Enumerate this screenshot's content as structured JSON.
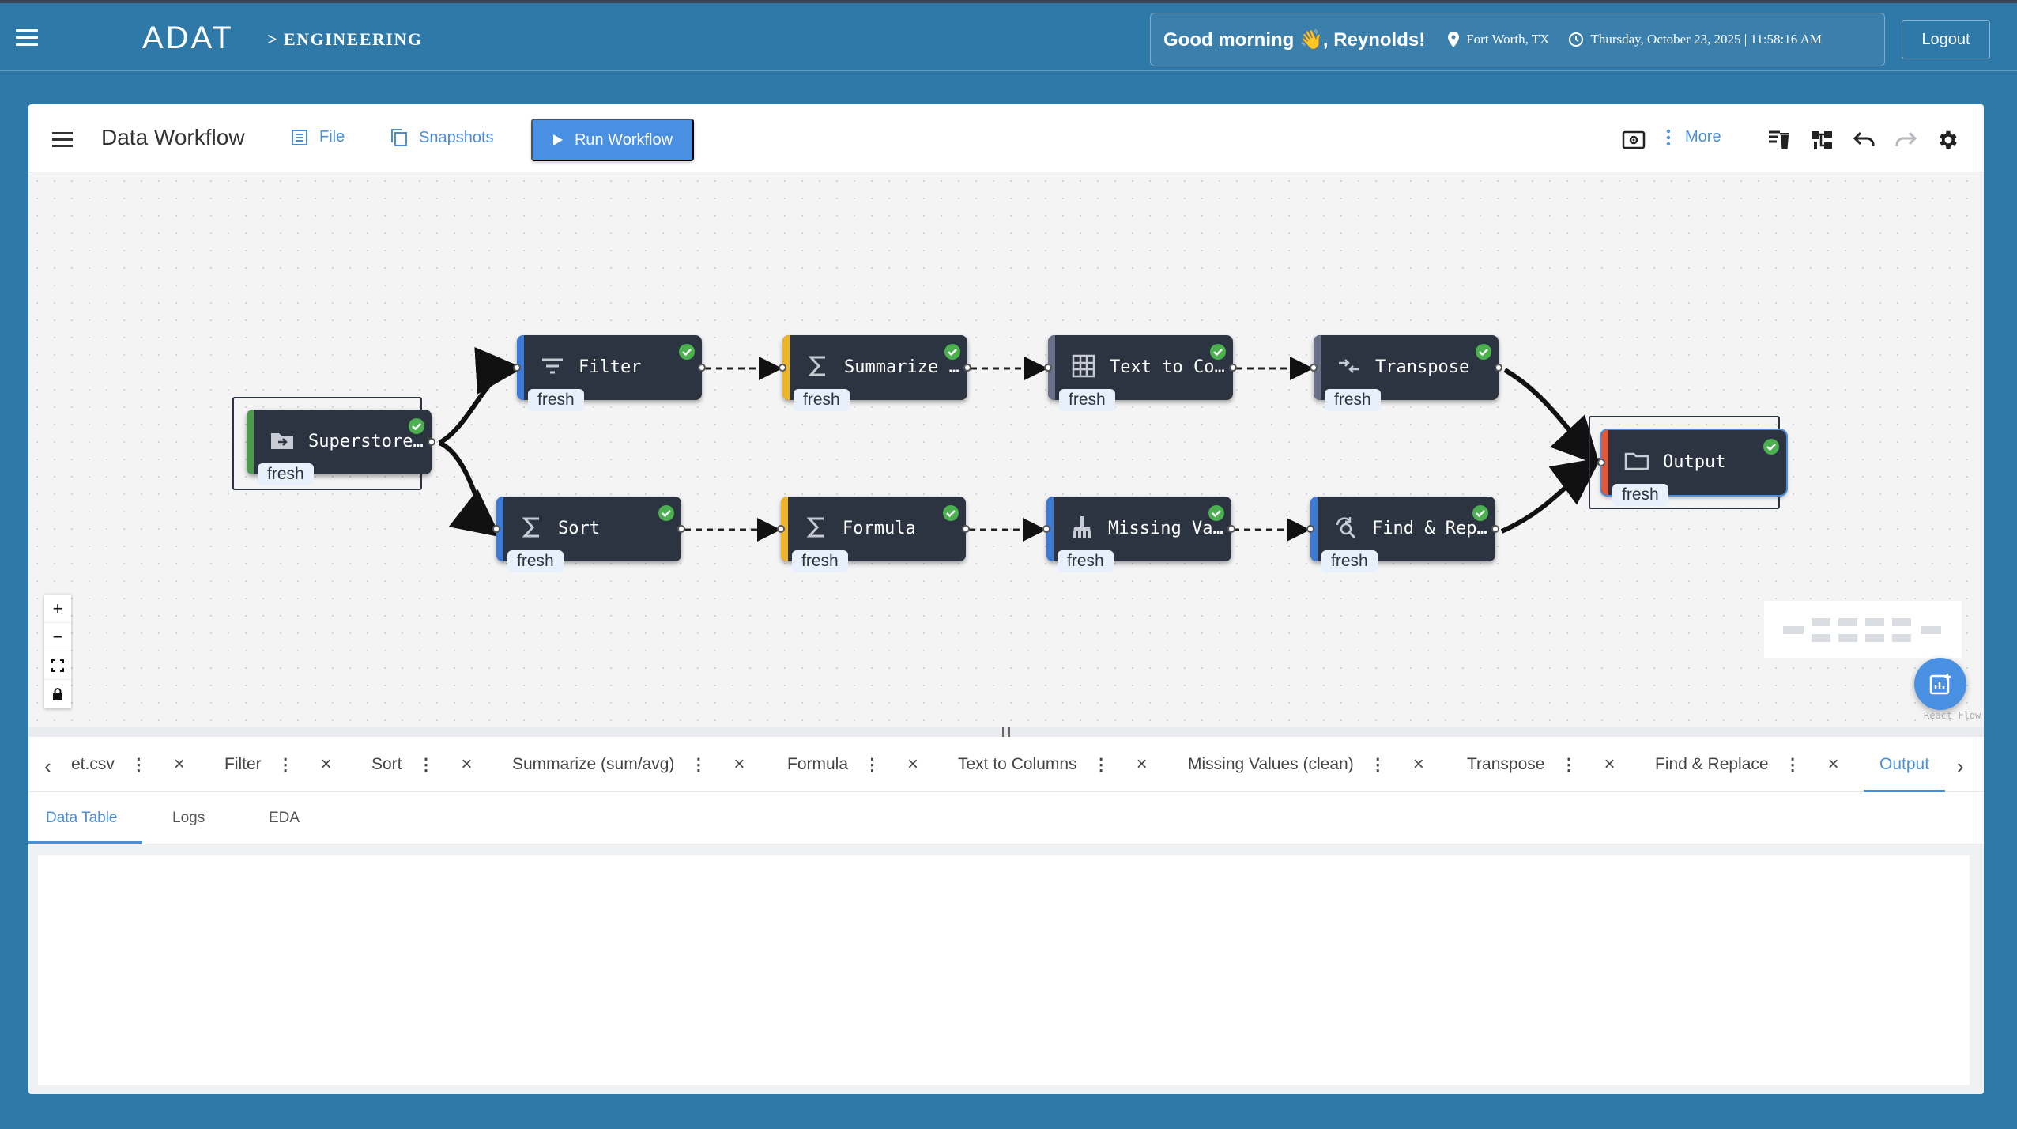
{
  "header": {
    "logo": "ADAT",
    "breadcrumb": "> ENGINEERING",
    "greeting": "Good morning 👋, Reynolds!",
    "location": "Fort Worth, TX",
    "datetime": "Thursday, October 23, 2025 | 11:58:16 AM",
    "logout_label": "Logout"
  },
  "toolbar": {
    "title": "Data Workflow",
    "file_label": "File",
    "snapshots_label": "Snapshots",
    "run_label": "Run Workflow",
    "more_label": "More"
  },
  "nodes": [
    {
      "label": "Superstore…",
      "badge": "fresh",
      "stripe": "#4c9a4c",
      "icon": "folder-in-icon"
    },
    {
      "label": "Filter",
      "badge": "fresh",
      "stripe": "#3d7ad6",
      "icon": "filter-icon"
    },
    {
      "label": "Summarize …",
      "badge": "fresh",
      "stripe": "#f0b429",
      "icon": "sigma-icon"
    },
    {
      "label": "Text to Co…",
      "badge": "fresh",
      "stripe": "#6a6f8a",
      "icon": "table-icon"
    },
    {
      "label": "Transpose",
      "badge": "fresh",
      "stripe": "#6a6f8a",
      "icon": "transpose-icon"
    },
    {
      "label": "Sort",
      "badge": "fresh",
      "stripe": "#3d7ad6",
      "icon": "sigma-icon"
    },
    {
      "label": "Formula",
      "badge": "fresh",
      "stripe": "#f0b429",
      "icon": "sigma-icon"
    },
    {
      "label": "Missing Va…",
      "badge": "fresh",
      "stripe": "#3d7ad6",
      "icon": "broom-icon"
    },
    {
      "label": "Find & Rep…",
      "badge": "fresh",
      "stripe": "#3d7ad6",
      "icon": "find-replace-icon"
    },
    {
      "label": "Output",
      "badge": "fresh",
      "stripe": "#e05a3a",
      "icon": "folder-icon"
    }
  ],
  "node_tabs": [
    {
      "label": "et.csv"
    },
    {
      "label": "Filter"
    },
    {
      "label": "Sort"
    },
    {
      "label": "Summarize (sum/avg)"
    },
    {
      "label": "Formula"
    },
    {
      "label": "Text to Columns"
    },
    {
      "label": "Missing Values (clean)"
    },
    {
      "label": "Transpose"
    },
    {
      "label": "Find & Replace"
    },
    {
      "label": "Output"
    }
  ],
  "sub_tabs": [
    "Data Table",
    "Logs",
    "EDA"
  ],
  "canvas": {
    "attribution": "React Flow"
  },
  "colors": {
    "accent": "#4a90e2",
    "node_bg": "#2c3442",
    "check": "#4caf50"
  }
}
